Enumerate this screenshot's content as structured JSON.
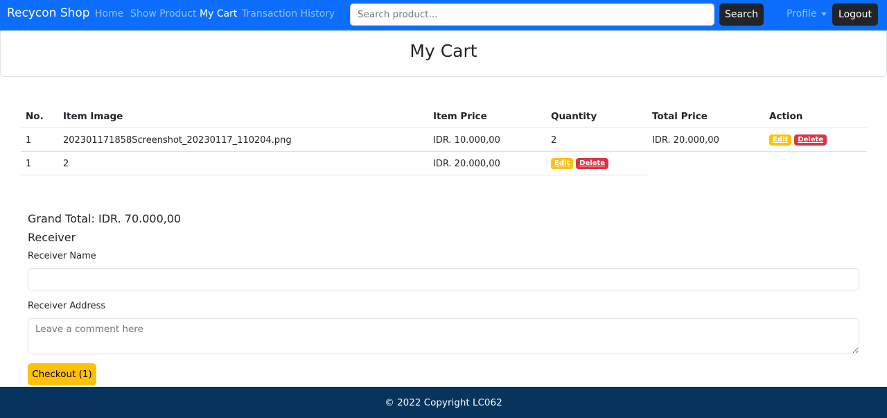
{
  "navbar": {
    "brand": "Recycon Shop",
    "links": [
      {
        "label": "Home",
        "active": false
      },
      {
        "label": "Show Product",
        "active": false
      },
      {
        "label": "My Cart",
        "active": true
      },
      {
        "label": "Transaction History",
        "active": false
      }
    ],
    "search_placeholder": "Search product...",
    "search_value": "",
    "search_label": "Search",
    "profile_label": "Profile",
    "logout_label": "Logout",
    "colors": {
      "navbar_bg": "#0d6efd",
      "dark_button": "#212529"
    }
  },
  "header": {
    "title": "My Cart"
  },
  "table": {
    "columns": [
      "No.",
      "Item Image",
      "Item Price",
      "Quantity",
      "Total Price",
      "Action"
    ],
    "rows": [
      {
        "no": "1",
        "item_image": "202301171858Screenshot_20230117_110204.png",
        "item_price": "IDR. 10.000,00",
        "quantity": "2",
        "total_price": "IDR. 20.000,00",
        "edit_label": "Edit",
        "delete_label": "Delete"
      },
      {
        "no": "1",
        "item_image": "2",
        "item_price": "IDR. 20.000,00",
        "edit_label": "Edit",
        "delete_label": "Delete"
      }
    ],
    "colors": {
      "edit": "#ffc107",
      "delete": "#dc3545"
    }
  },
  "summary": {
    "grand_total": "Grand Total: IDR. 70.000,00",
    "receiver_heading": "Receiver"
  },
  "form": {
    "receiver_name_label": "Receiver Name",
    "receiver_name_value": "",
    "receiver_address_label": "Receiver Address",
    "receiver_address_placeholder": "Leave a comment here",
    "checkout_label": "Checkout (1)",
    "checkout_color": "#ffc107"
  },
  "footer": {
    "text": "© 2022 Copyright LC062",
    "bg": "#07345d"
  }
}
